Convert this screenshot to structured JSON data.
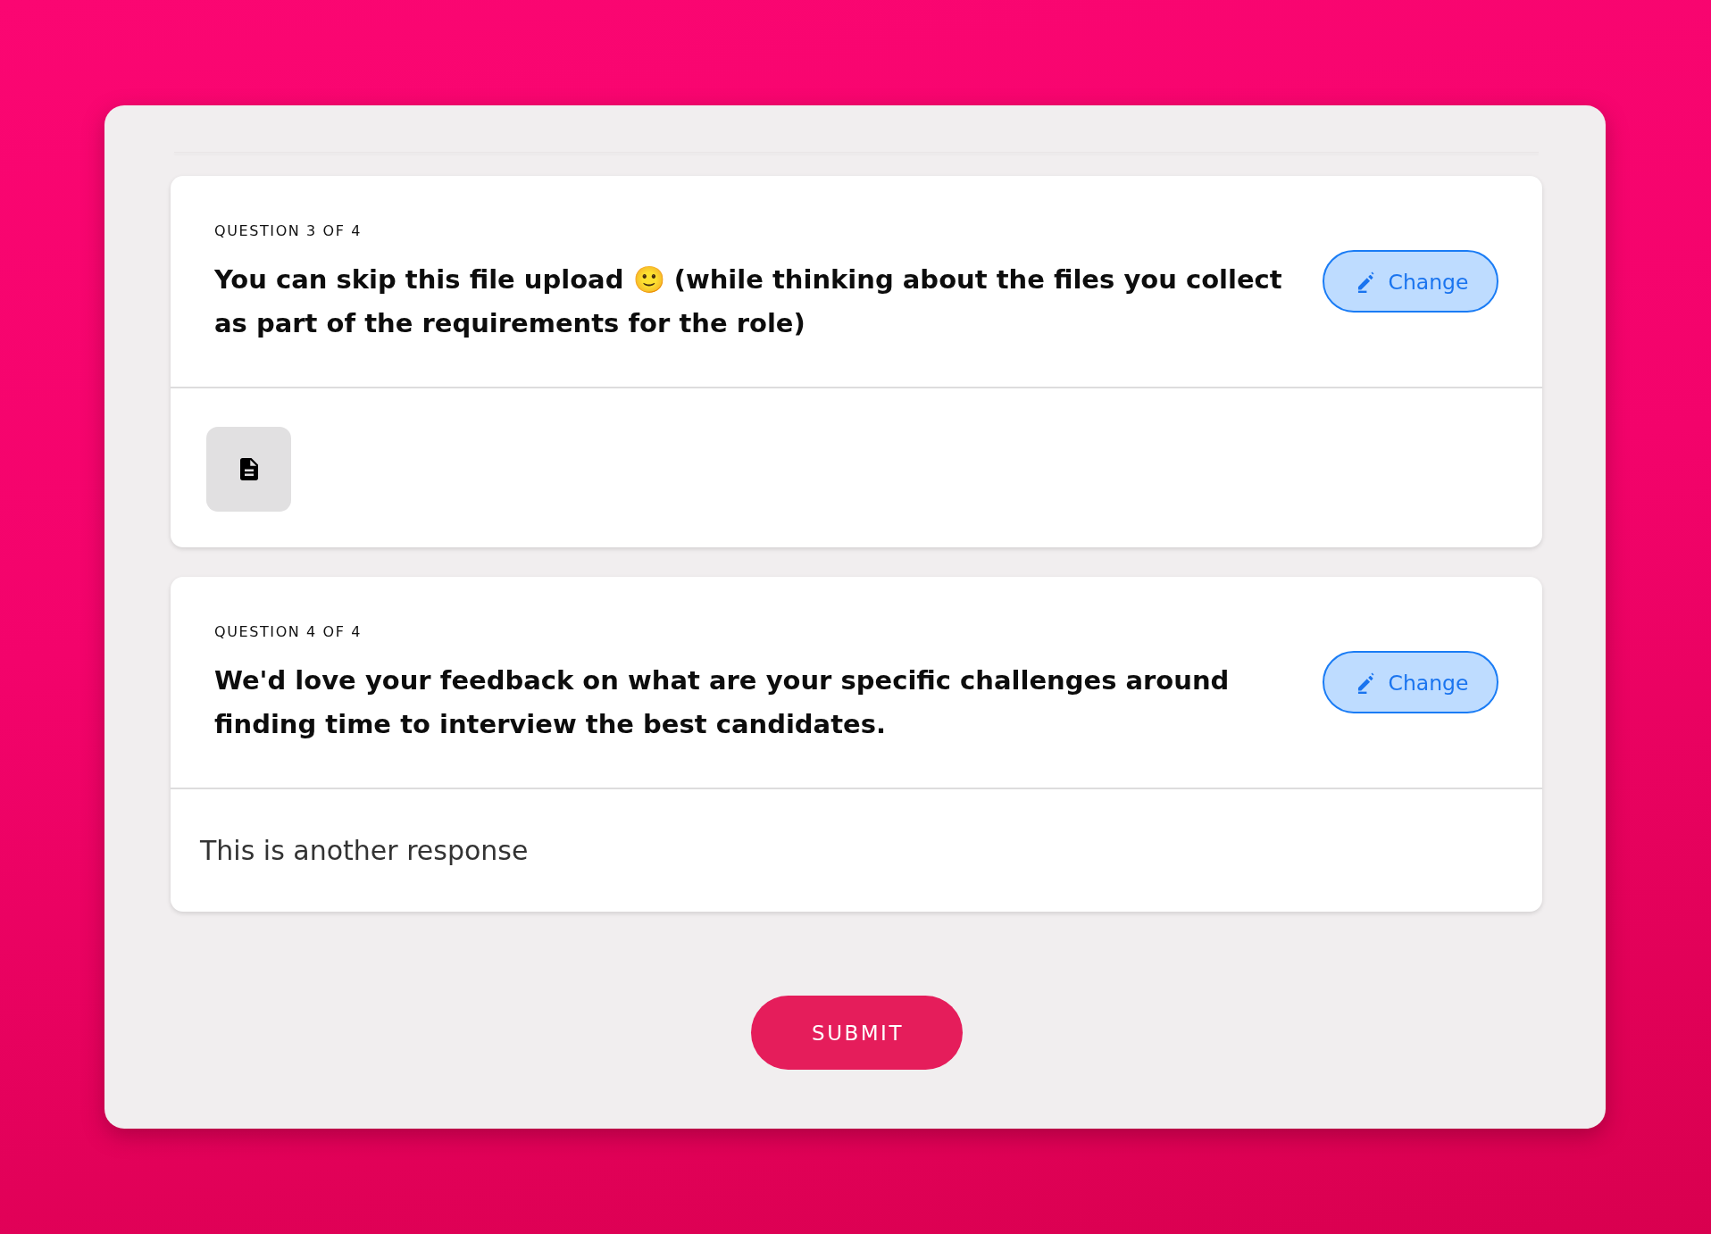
{
  "questions": [
    {
      "label": "QUESTION 3 OF 4",
      "title": "You can skip this file upload 🙂 (while thinking about the files you collect as part of the requirements for the role)",
      "change_button": "Change",
      "answer": {
        "kind": "file"
      }
    },
    {
      "label": "QUESTION 4 OF 4",
      "title": "We'd love your feedback on what are your specific challenges around finding time to interview the best candidates.",
      "change_button": "Change",
      "answer": {
        "kind": "text",
        "text": "This is another response"
      }
    }
  ],
  "submit_button": "SUBMIT"
}
